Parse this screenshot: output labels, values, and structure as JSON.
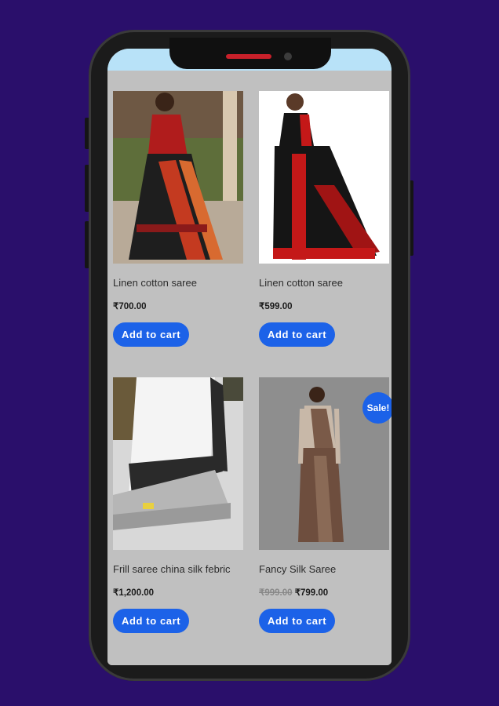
{
  "products": [
    {
      "name": "Linen cotton saree",
      "price": "₹700.00",
      "button": "Add to cart"
    },
    {
      "name": "Linen cotton saree",
      "price": "₹599.00",
      "button": "Add to cart"
    },
    {
      "name": "Frill saree china silk febric",
      "price": "₹1,200.00",
      "button": "Add to cart"
    },
    {
      "name": "Fancy Silk Saree",
      "old_price": "₹999.00",
      "price": "₹799.00",
      "button": "Add to cart",
      "badge": "Sale!"
    }
  ],
  "colors": {
    "background": "#2a0f6b",
    "button": "#1c62e8",
    "screen": "#c0c0c0"
  }
}
